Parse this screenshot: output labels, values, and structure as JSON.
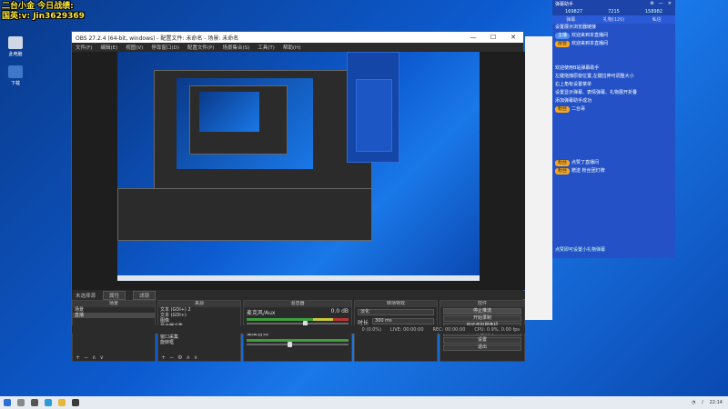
{
  "overlay": {
    "line1": "二台小金 今日战绩:",
    "line2": "国英:v: Jin3629369"
  },
  "desktop": {
    "icons": [
      {
        "label": "此电脑",
        "icon": "computer-icon"
      },
      {
        "label": "下载",
        "icon": "download-folder-icon"
      }
    ]
  },
  "obs": {
    "title": "OBS 27.2.4 (64-bit, windows) - 配置文件: 未命名 - 场景: 未命名",
    "window_buttons": [
      "—",
      "☐",
      "✕"
    ],
    "menu": [
      "文件(F)",
      "编辑(E)",
      "视图(V)",
      "停靠窗口(D)",
      "配置文件(P)",
      "场景集合(S)",
      "工具(T)",
      "帮助(H)"
    ],
    "scene_bar": {
      "label": "未选择源",
      "props": "属性",
      "filters": "滤镜"
    },
    "docks": {
      "scenes": {
        "title": "场景",
        "items": [
          "场景",
          "直播"
        ],
        "selected": 1
      },
      "sources": {
        "title": "来源",
        "items": [
          "文本 (GDI+) 2",
          "文本 (GDI+)",
          "图像",
          "显示器采集",
          "旋转框 2",
          "窗口采集",
          "旋转框"
        ]
      },
      "mixer": {
        "title": "混音器",
        "channels": [
          {
            "name": "麦克风/Aux",
            "db": "0.0 dB"
          },
          {
            "name": "桌面音频",
            "db": "-12.6 dB"
          }
        ]
      },
      "transitions": {
        "title": "转场特效",
        "type": "淡化",
        "duration_label": "时长",
        "duration": "300 ms"
      },
      "controls": {
        "title": "控件",
        "buttons": [
          "停止推流",
          "开始录制",
          "启动虚拟摄像机",
          "工作室模式",
          "设置",
          "退出"
        ]
      }
    },
    "status": {
      "dropped": "0 (0.0%)",
      "live": "LIVE: 00:00:00",
      "rec": "REC: 00:00:00",
      "cpu": "CPU: 0.9%, 0.00 fps"
    }
  },
  "danmu": {
    "title": "弹幕助手",
    "stats": [
      "169827",
      "7215",
      "158982"
    ],
    "tabs": [
      "弹幕",
      "礼物(120)",
      "私信"
    ],
    "messages": [
      {
        "text": "设置展示浏览器链接",
        "badge": ""
      },
      {
        "text": "欢迎来到本直播间",
        "badge": "主播"
      },
      {
        "text": "欢迎来到本直播间",
        "badge": "房管"
      },
      {
        "text": "欢迎使用B站弹幕助手",
        "badge": ""
      },
      {
        "text": "左键拖拽原窗位置,左键拉伸可调整大小",
        "badge": ""
      },
      {
        "text": "右上角有设置菜单",
        "badge": ""
      },
      {
        "text": "设置显示弹幕、表情弹幕、礼物展开折叠",
        "badge": ""
      },
      {
        "text": "添加弹幕助手成功",
        "badge": ""
      },
      {
        "text": "二台哥",
        "badge": "粉丝"
      },
      {
        "text": "点赞了直播间",
        "badge": "粉丝"
      },
      {
        "text": "赠送 粉丝团灯牌",
        "badge": "粉丝"
      }
    ],
    "footer": "点赞即可设置小礼物弹幕"
  },
  "taskbar": {
    "time": "22:14",
    "date": "2023/1/12"
  }
}
